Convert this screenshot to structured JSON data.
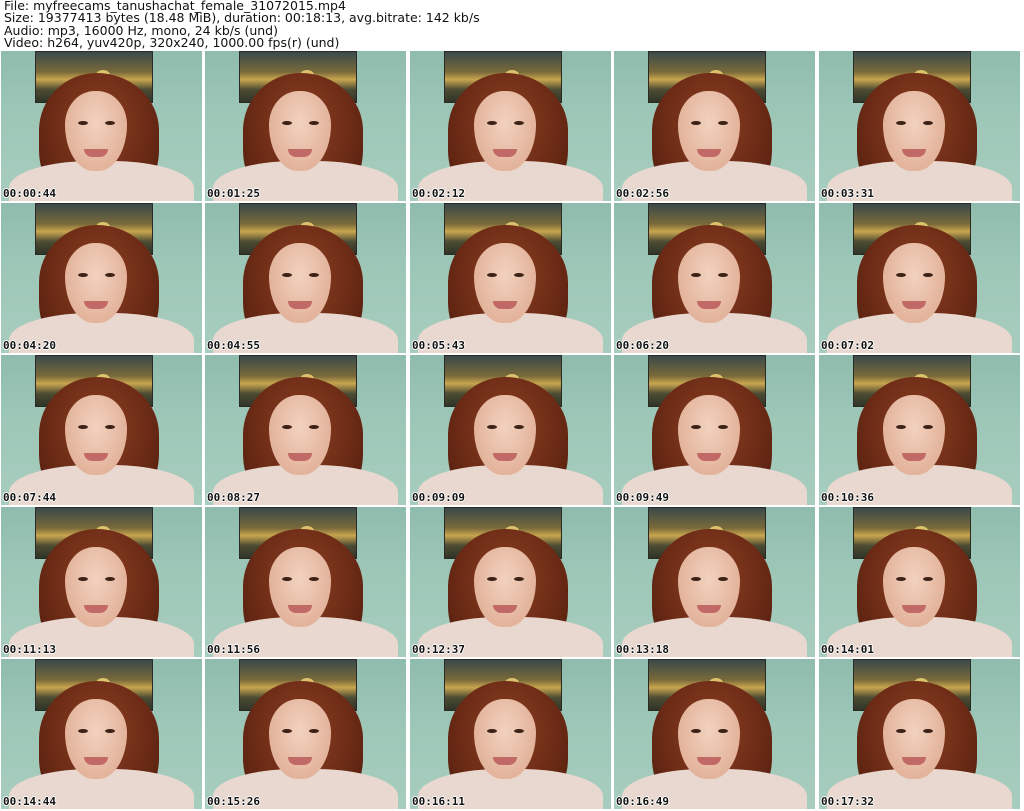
{
  "header": {
    "file": "File: myfreecams_tanushachat_female_31072015.mp4",
    "size": "Size: 19377413 bytes (18.48 MiB), duration: 00:18:13, avg.bitrate: 142 kb/s",
    "audio": "Audio: mp3, 16000 Hz, mono, 24 kb/s (und)",
    "video": "Video: h264, yuv420p, 320x240, 1000.00 fps(r) (und)"
  },
  "thumbnails": [
    {
      "timestamp": "00:00:44"
    },
    {
      "timestamp": "00:01:25"
    },
    {
      "timestamp": "00:02:12"
    },
    {
      "timestamp": "00:02:56"
    },
    {
      "timestamp": "00:03:31"
    },
    {
      "timestamp": "00:04:20"
    },
    {
      "timestamp": "00:04:55"
    },
    {
      "timestamp": "00:05:43"
    },
    {
      "timestamp": "00:06:20"
    },
    {
      "timestamp": "00:07:02"
    },
    {
      "timestamp": "00:07:44"
    },
    {
      "timestamp": "00:08:27"
    },
    {
      "timestamp": "00:09:09"
    },
    {
      "timestamp": "00:09:49"
    },
    {
      "timestamp": "00:10:36"
    },
    {
      "timestamp": "00:11:13"
    },
    {
      "timestamp": "00:11:56"
    },
    {
      "timestamp": "00:12:37"
    },
    {
      "timestamp": "00:13:18"
    },
    {
      "timestamp": "00:14:01"
    },
    {
      "timestamp": "00:14:44"
    },
    {
      "timestamp": "00:15:26"
    },
    {
      "timestamp": "00:16:11"
    },
    {
      "timestamp": "00:16:49"
    },
    {
      "timestamp": "00:17:32"
    }
  ]
}
